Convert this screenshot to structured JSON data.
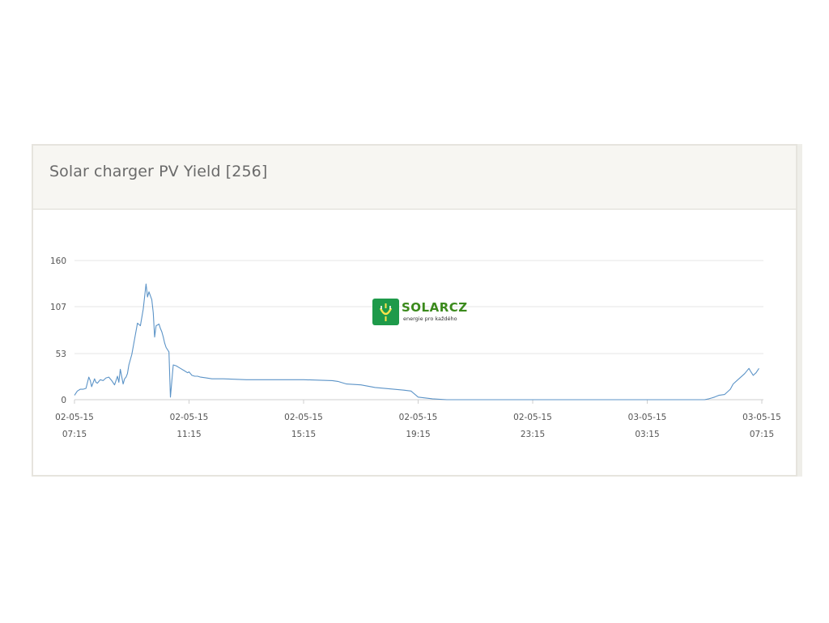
{
  "panel": {
    "title": "Solar charger PV Yield [256]"
  },
  "logo": {
    "name": "SOLARCZ",
    "tagline": "energie pro každého"
  },
  "chart_data": {
    "type": "line",
    "title": "Solar charger PV Yield [256]",
    "xlabel": "",
    "ylabel": "",
    "ylim": [
      0,
      160
    ],
    "yticks": [
      0,
      53,
      107,
      160
    ],
    "xticks": [
      {
        "date": "02-05-15",
        "time": "07:15"
      },
      {
        "date": "02-05-15",
        "time": "11:15"
      },
      {
        "date": "02-05-15",
        "time": "15:15"
      },
      {
        "date": "02-05-15",
        "time": "19:15"
      },
      {
        "date": "02-05-15",
        "time": "23:15"
      },
      {
        "date": "03-05-15",
        "time": "03:15"
      },
      {
        "date": "03-05-15",
        "time": "07:15"
      }
    ],
    "x_unit": "hours from 02-05-15 07:15",
    "xlim": [
      0,
      24
    ],
    "grid": true,
    "color": "#5b93c7",
    "series": [
      {
        "x": [
          0,
          0.1,
          0.2,
          0.3,
          0.4,
          0.5,
          0.55,
          0.6,
          0.7,
          0.75,
          0.8,
          0.9,
          1.0,
          1.1,
          1.2,
          1.3,
          1.4,
          1.5,
          1.55,
          1.6,
          1.7,
          1.75,
          1.8,
          1.85,
          1.9,
          2.0,
          2.1,
          2.2,
          2.3,
          2.4,
          2.5,
          2.55,
          2.6,
          2.7,
          2.75,
          2.8,
          2.85,
          2.9,
          2.95,
          3.0,
          3.05,
          3.1,
          3.15,
          3.2,
          3.3,
          3.35,
          3.45,
          3.55,
          3.7,
          3.85,
          3.95,
          4.0,
          4.05,
          4.1,
          4.2,
          4.3,
          4.4,
          4.6,
          4.8,
          5.2,
          6.0,
          7.0,
          8.0,
          9.0,
          9.2,
          9.3,
          9.5,
          10.0,
          10.5,
          11.5,
          11.75,
          12.0,
          12.5,
          13.0,
          15.0,
          17.0,
          20.0,
          22.0,
          22.15,
          22.25,
          22.35,
          22.5,
          22.7,
          22.9,
          23.0,
          23.2,
          23.4,
          23.55,
          23.6,
          23.7,
          23.8,
          23.9
        ],
        "y": [
          5,
          10,
          12,
          12,
          13,
          26,
          22,
          15,
          24,
          20,
          19,
          23,
          22,
          25,
          26,
          22,
          17,
          27,
          20,
          35,
          18,
          24,
          26,
          30,
          40,
          52,
          70,
          88,
          85,
          104,
          133,
          118,
          124,
          115,
          100,
          72,
          85,
          86,
          87,
          82,
          78,
          72,
          65,
          60,
          55,
          3,
          40,
          39,
          36,
          33,
          31,
          32,
          30,
          28,
          27,
          27,
          26,
          25,
          24,
          24,
          23,
          23,
          23,
          22,
          21,
          20,
          18,
          17,
          14,
          11,
          10,
          3,
          1,
          0,
          0,
          0,
          0,
          0,
          1,
          2,
          3,
          5,
          6,
          12,
          18,
          24,
          30,
          36,
          33,
          28,
          31,
          36
        ]
      }
    ]
  }
}
